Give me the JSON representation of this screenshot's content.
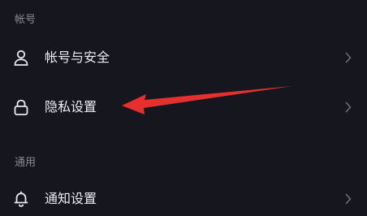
{
  "sections": [
    {
      "header": "帐号",
      "items": [
        {
          "label": "帐号与安全",
          "icon": "person-icon"
        },
        {
          "label": "隐私设置",
          "icon": "lock-icon"
        }
      ]
    },
    {
      "header": "通用",
      "items": [
        {
          "label": "通知设置",
          "icon": "bell-icon"
        }
      ]
    }
  ],
  "colors": {
    "background": "#16161f",
    "text_primary": "#ececf0",
    "text_secondary": "#8a8a95",
    "chevron": "#6e6e78",
    "annotation_arrow": "#e5302e"
  }
}
